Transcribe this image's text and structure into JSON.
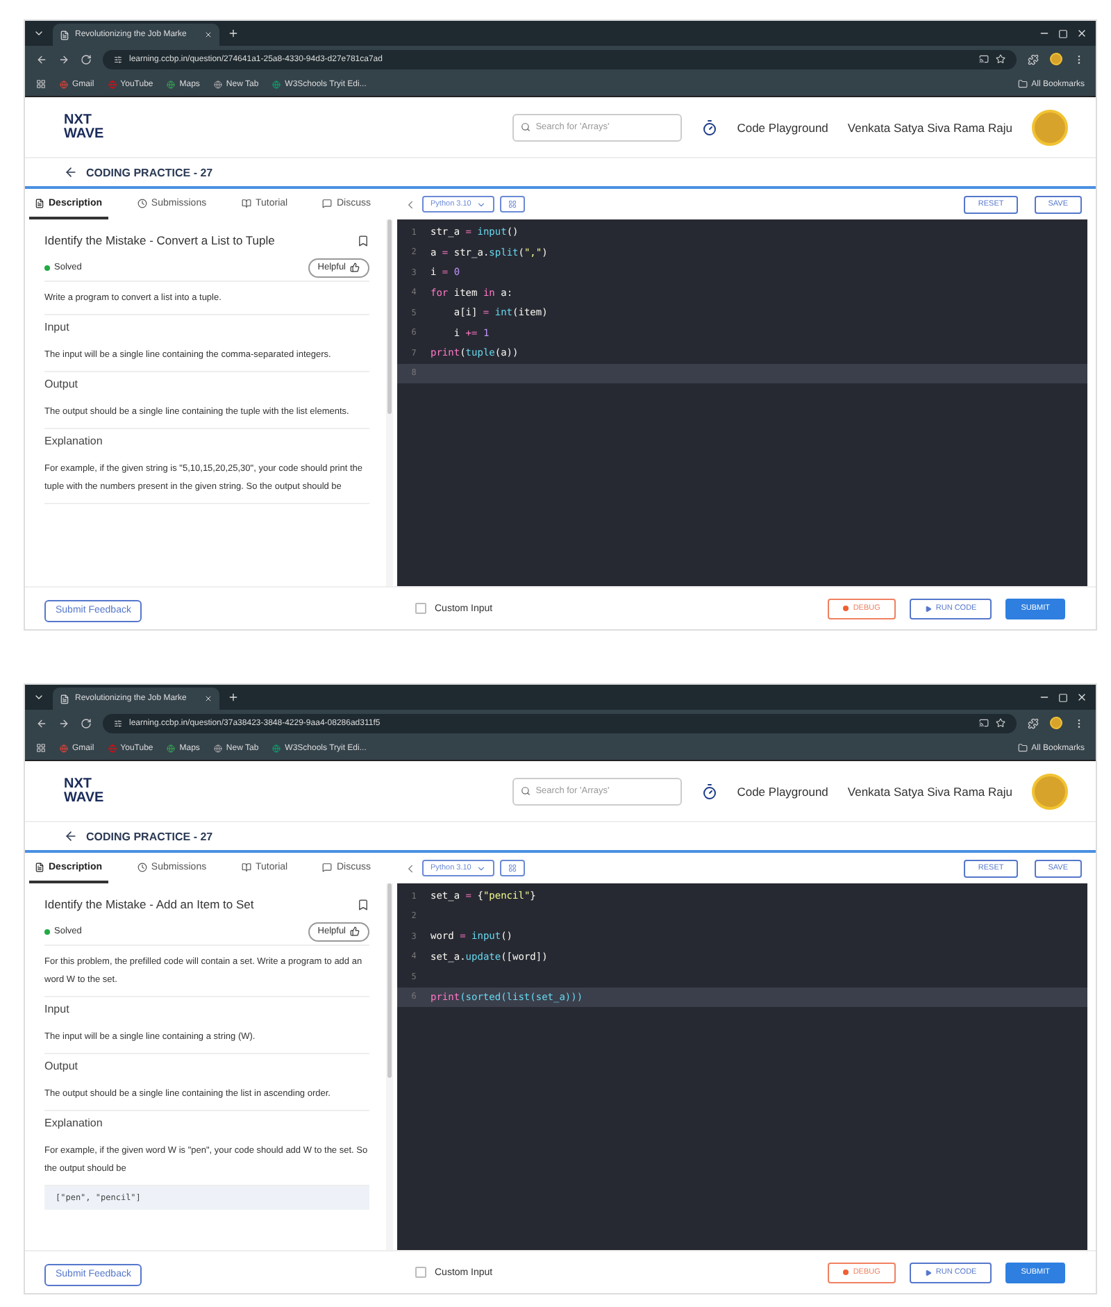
{
  "shots": [
    {
      "browser": {
        "tab_title": "Revolutionizing the Job Marke",
        "url": "learning.ccbp.in/question/274641a1-25a8-4330-94d3-d27e781ca7ad",
        "bookmarks": [
          "Gmail",
          "YouTube",
          "Maps",
          "New Tab",
          "W3Schools Tryit Edi..."
        ],
        "all_bookmarks": "All Bookmarks"
      },
      "header": {
        "logo_top": "NXT",
        "logo_bottom": "WAVE",
        "search": {
          "placeholder": "Search for 'Arrays'"
        },
        "playground": "Code Playground",
        "user": "Venkata Satya Siva Rama Raju"
      },
      "back_title": "CODING PRACTICE - 27",
      "tabs": [
        {
          "label": "Description",
          "selected": true
        },
        {
          "label": "Submissions",
          "selected": false
        },
        {
          "label": "Tutorial",
          "selected": false
        },
        {
          "label": "Discuss",
          "selected": false
        }
      ],
      "problem": {
        "title": "Identify the Mistake - Convert a List to Tuple",
        "status": "Solved",
        "helpful": "Helpful",
        "sections": [
          {
            "kind": "paragraph",
            "text": "Write a program to convert a list into a tuple."
          },
          {
            "kind": "heading",
            "text": "Input"
          },
          {
            "kind": "paragraph",
            "text": "The input will be a single line containing the comma-separated integers."
          },
          {
            "kind": "heading",
            "text": "Output"
          },
          {
            "kind": "paragraph",
            "text": "The output should be a single line containing the tuple with the list elements."
          },
          {
            "kind": "heading",
            "text": "Explanation"
          },
          {
            "kind": "paragraph",
            "text": "For example, if the given string is \"5,10,15,20,25,30\", your code should print the tuple with the numbers present in the given string. So the output should be"
          }
        ]
      },
      "editor": {
        "language": "Python 3.10",
        "reset": "RESET",
        "save": "SAVE",
        "lines": [
          {
            "number": "1",
            "current": false,
            "tokens": [
              {
                "text": "str_a",
                "kind": "plain"
              },
              {
                "text": " = ",
                "kind": "op"
              },
              {
                "text": "input",
                "kind": "func"
              },
              {
                "text": "()",
                "kind": "plain"
              }
            ]
          },
          {
            "number": "2",
            "current": false,
            "tokens": [
              {
                "text": "a",
                "kind": "plain"
              },
              {
                "text": " = ",
                "kind": "op"
              },
              {
                "text": "str_a.",
                "kind": "plain"
              },
              {
                "text": "split",
                "kind": "func"
              },
              {
                "text": "(",
                "kind": "plain"
              },
              {
                "text": "\",\"",
                "kind": "string"
              },
              {
                "text": ")",
                "kind": "plain"
              }
            ]
          },
          {
            "number": "3",
            "current": false,
            "tokens": [
              {
                "text": "i",
                "kind": "plain"
              },
              {
                "text": " = ",
                "kind": "op"
              },
              {
                "text": "0",
                "kind": "number"
              }
            ]
          },
          {
            "number": "4",
            "current": false,
            "tokens": [
              {
                "text": "for",
                "kind": "keyword"
              },
              {
                "text": " item ",
                "kind": "plain"
              },
              {
                "text": "in",
                "kind": "keyword"
              },
              {
                "text": " a:",
                "kind": "plain"
              }
            ]
          },
          {
            "number": "5",
            "current": false,
            "tokens": [
              {
                "text": "    a[i]",
                "kind": "plain"
              },
              {
                "text": " = ",
                "kind": "op"
              },
              {
                "text": "int",
                "kind": "func"
              },
              {
                "text": "(item)",
                "kind": "plain"
              }
            ]
          },
          {
            "number": "6",
            "current": false,
            "tokens": [
              {
                "text": "    i",
                "kind": "plain"
              },
              {
                "text": " += ",
                "kind": "op"
              },
              {
                "text": "1",
                "kind": "number"
              }
            ]
          },
          {
            "number": "7",
            "current": false,
            "tokens": [
              {
                "text": "print",
                "kind": "keyword"
              },
              {
                "text": "(",
                "kind": "plain"
              },
              {
                "text": "tuple",
                "kind": "func"
              },
              {
                "text": "(a))",
                "kind": "plain"
              }
            ]
          },
          {
            "number": "8",
            "current": true
          }
        ]
      },
      "footer": {
        "feedback": "Submit Feedback",
        "custom_input": {
          "label": "Custom Input",
          "checked": false
        },
        "debug": "DEBUG",
        "run": "RUN CODE",
        "submit": "SUBMIT"
      }
    },
    {
      "browser": {
        "tab_title": "Revolutionizing the Job Marke",
        "url": "learning.ccbp.in/question/37a38423-3848-4229-9aa4-08286ad311f5",
        "bookmarks": [
          "Gmail",
          "YouTube",
          "Maps",
          "New Tab",
          "W3Schools Tryit Edi..."
        ],
        "all_bookmarks": "All Bookmarks"
      },
      "header": {
        "logo_top": "NXT",
        "logo_bottom": "WAVE",
        "search": {
          "placeholder": "Search for 'Arrays'"
        },
        "playground": "Code Playground",
        "user": "Venkata Satya Siva Rama Raju"
      },
      "back_title": "CODING PRACTICE - 27",
      "tabs": [
        {
          "label": "Description",
          "selected": true
        },
        {
          "label": "Submissions",
          "selected": false
        },
        {
          "label": "Tutorial",
          "selected": false
        },
        {
          "label": "Discuss",
          "selected": false
        }
      ],
      "problem": {
        "title": "Identify the Mistake - Add an Item to Set",
        "status": "Solved",
        "helpful": "Helpful",
        "sections": [
          {
            "kind": "paragraph",
            "text": "For this problem, the prefilled code will contain a set. Write a program to add an word W to the set."
          },
          {
            "kind": "heading",
            "text": "Input"
          },
          {
            "kind": "paragraph",
            "text": "The input will be a single line containing a string (W)."
          },
          {
            "kind": "heading",
            "text": "Output"
          },
          {
            "kind": "paragraph",
            "text": "The output should be a single line containing the list in ascending order."
          },
          {
            "kind": "heading",
            "text": "Explanation"
          },
          {
            "kind": "paragraph",
            "text": "For example, if the given word W is \"pen\", your code should add W to the set. So the output should be"
          },
          {
            "kind": "code",
            "text": "[\"pen\", \"pencil\"]"
          }
        ]
      },
      "editor": {
        "language": "Python 3.10",
        "reset": "RESET",
        "save": "SAVE",
        "lines": [
          {
            "number": "1",
            "current": false,
            "tokens": [
              {
                "text": "set_a",
                "kind": "plain"
              },
              {
                "text": " = ",
                "kind": "op"
              },
              {
                "text": "{",
                "kind": "plain"
              },
              {
                "text": "\"pencil\"",
                "kind": "string"
              },
              {
                "text": "}",
                "kind": "plain"
              }
            ]
          },
          {
            "number": "2",
            "current": false
          },
          {
            "number": "3",
            "current": false,
            "tokens": [
              {
                "text": "word",
                "kind": "plain"
              },
              {
                "text": " = ",
                "kind": "op"
              },
              {
                "text": "input",
                "kind": "func"
              },
              {
                "text": "()",
                "kind": "plain"
              }
            ]
          },
          {
            "number": "4",
            "current": false,
            "tokens": [
              {
                "text": "set_a.",
                "kind": "plain"
              },
              {
                "text": "update",
                "kind": "func"
              },
              {
                "text": "([word])",
                "kind": "plain"
              }
            ]
          },
          {
            "number": "5",
            "current": false
          },
          {
            "number": "6",
            "current": true,
            "tokens": [
              {
                "text": "print",
                "kind": "keyword"
              },
              {
                "text": "(sorted(list(set_a)))",
                "kind": "func"
              }
            ]
          }
        ]
      },
      "footer": {
        "feedback": "Submit Feedback",
        "custom_input": {
          "label": "Custom Input",
          "checked": false
        },
        "debug": "DEBUG",
        "run": "RUN CODE",
        "submit": "SUBMIT"
      }
    }
  ]
}
